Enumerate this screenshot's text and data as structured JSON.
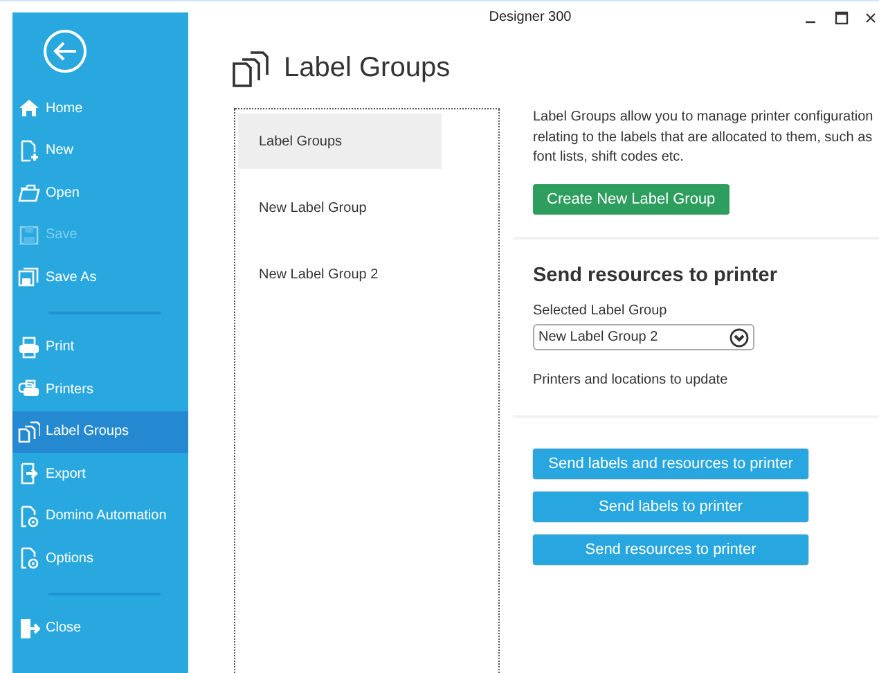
{
  "window": {
    "title": "Designer 300"
  },
  "sidebar": {
    "groups": [
      [
        {
          "label": "Home",
          "selected": false,
          "disabled": false
        },
        {
          "label": "New",
          "selected": false,
          "disabled": false
        },
        {
          "label": "Open",
          "selected": false,
          "disabled": false
        },
        {
          "label": "Save",
          "selected": false,
          "disabled": true
        },
        {
          "label": "Save As",
          "selected": false,
          "disabled": false
        }
      ],
      [
        {
          "label": "Print",
          "selected": false,
          "disabled": false
        },
        {
          "label": "Printers",
          "selected": false,
          "disabled": false
        },
        {
          "label": "Label Groups",
          "selected": true,
          "disabled": false
        },
        {
          "label": "Export",
          "selected": false,
          "disabled": false
        },
        {
          "label": "Domino Automation",
          "selected": false,
          "disabled": false
        },
        {
          "label": "Options",
          "selected": false,
          "disabled": false
        }
      ],
      [
        {
          "label": "Close",
          "selected": false,
          "disabled": false
        }
      ]
    ]
  },
  "page": {
    "title": "Label Groups"
  },
  "groups_list": [
    {
      "label": "Label Groups",
      "selected": true
    },
    {
      "label": "New Label Group",
      "selected": false
    },
    {
      "label": "New Label Group 2",
      "selected": false
    }
  ],
  "description": "Label Groups allow you to manage printer configuration relating to the labels that are allocated to them, such as font lists, shift codes etc.",
  "create_button": "Create New Label Group",
  "send_section": {
    "heading": "Send resources to printer",
    "select_label": "Selected Label Group",
    "select_value": "New Label Group 2",
    "printers_label": "Printers and locations to update",
    "buttons": [
      "Send labels and resources to printer",
      "Send labels to printer",
      "Send resources to printer"
    ]
  }
}
